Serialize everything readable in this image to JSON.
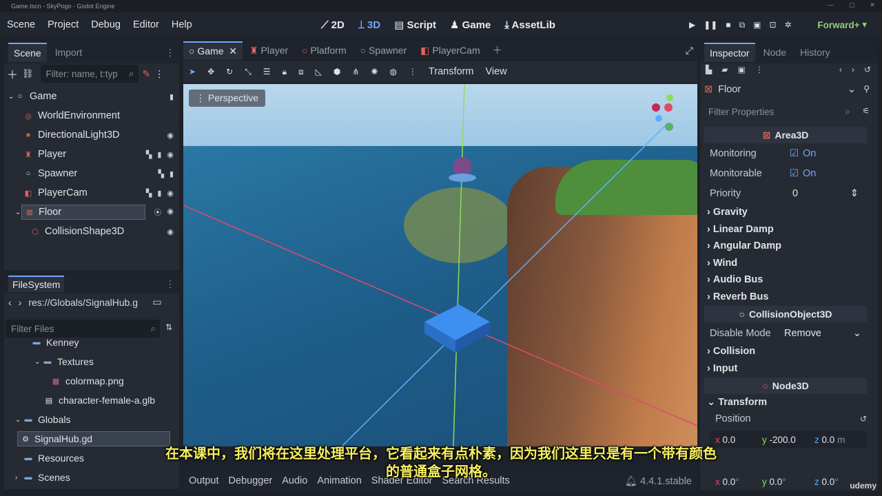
{
  "window": {
    "title": "Game.tscn - SkyPogo - Godot Engine"
  },
  "menu": {
    "items": [
      "Scene",
      "Project",
      "Debug",
      "Editor",
      "Help"
    ]
  },
  "modes": {
    "2d": "2D",
    "3d": "3D",
    "script": "Script",
    "game": "Game",
    "assetlib": "AssetLib"
  },
  "renderer": "Forward+",
  "scene_panel": {
    "tabs": [
      "Scene",
      "Import"
    ],
    "filter_placeholder": "Filter: name, t:typ",
    "nodes": [
      {
        "label": "Game"
      },
      {
        "label": "WorldEnvironment"
      },
      {
        "label": "DirectionalLight3D"
      },
      {
        "label": "Player"
      },
      {
        "label": "Spawner"
      },
      {
        "label": "PlayerCam"
      },
      {
        "label": "Floor"
      },
      {
        "label": "CollisionShape3D"
      }
    ]
  },
  "filesystem": {
    "title": "FileSystem",
    "path": "res://Globals/SignalHub.g",
    "filter_placeholder": "Filter Files",
    "items": [
      {
        "label": "Kenney"
      },
      {
        "label": "Textures"
      },
      {
        "label": "colormap.png"
      },
      {
        "label": "character-female-a.glb"
      },
      {
        "label": "Globals"
      },
      {
        "label": "SignalHub.gd"
      },
      {
        "label": "Resources"
      },
      {
        "label": "Scenes"
      }
    ]
  },
  "editor_tabs": [
    "Game",
    "Player",
    "Platform",
    "Spawner",
    "PlayerCam"
  ],
  "toolbar": {
    "transform": "Transform",
    "view": "View"
  },
  "viewport": {
    "perspective_label": "Perspective"
  },
  "bottom_panel": {
    "tabs": [
      "Output",
      "Debugger",
      "Audio",
      "Animation",
      "Shader Editor",
      "Search Results"
    ],
    "version": "4.4.1.stable"
  },
  "inspector": {
    "tabs": [
      "Inspector",
      "Node",
      "History"
    ],
    "node_name": "Floor",
    "filter_placeholder": "Filter Properties",
    "area3d_header": "Area3D",
    "monitoring_label": "Monitoring",
    "monitoring_value": "On",
    "monitorable_label": "Monitorable",
    "monitorable_value": "On",
    "priority_label": "Priority",
    "priority_value": "0",
    "groups1": [
      "Gravity",
      "Linear Damp",
      "Angular Damp",
      "Wind",
      "Audio Bus",
      "Reverb Bus"
    ],
    "collision_header": "CollisionObject3D",
    "disable_mode_label": "Disable Mode",
    "disable_mode_value": "Remove",
    "groups2": [
      "Collision",
      "Input"
    ],
    "node3d_header": "Node3D",
    "transform_label": "Transform",
    "position_label": "Position",
    "position": {
      "x": "0.0",
      "y": "-200.0",
      "z": "0.0",
      "unit": "m"
    },
    "rotation": {
      "x": "0.0",
      "y": "0.0",
      "z": "0.0",
      "unit": "°"
    }
  },
  "subtitle": {
    "line1": "在本课中，我们将在这里处理平台，它看起来有点朴素，因为我们这里只是有一个带有颜色",
    "line2": "的普通盒子网格。"
  },
  "watermark": "udemy",
  "colors": {
    "accent": "#6fa8ff",
    "renderer": "#8fd17a",
    "subtitle": "#f7f060"
  }
}
